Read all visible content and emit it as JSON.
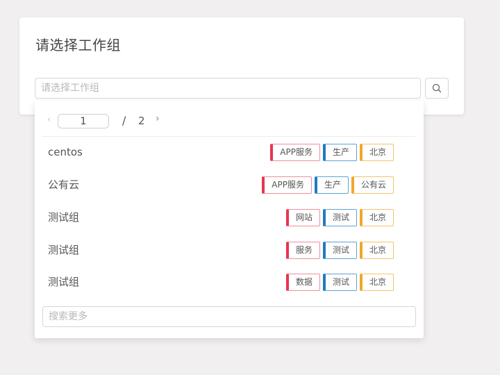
{
  "card": {
    "title": "请选择工作组",
    "search_placeholder": "请选择工作组",
    "search_value": ""
  },
  "pager": {
    "prev_icon": "chevron-left-icon",
    "current_page": "1",
    "separator": "/",
    "total_pages": "2",
    "next_icon": "chevron-right-icon"
  },
  "items": [
    {
      "name": "centos",
      "tags": [
        {
          "text": "APP服务",
          "color": "red"
        },
        {
          "text": "生产",
          "color": "blue"
        },
        {
          "text": "北京",
          "color": "orange"
        }
      ]
    },
    {
      "name": "公有云",
      "tags": [
        {
          "text": "APP服务",
          "color": "red"
        },
        {
          "text": "生产",
          "color": "blue"
        },
        {
          "text": "公有云",
          "color": "orange"
        }
      ]
    },
    {
      "name": "测试组",
      "tags": [
        {
          "text": "网站",
          "color": "red"
        },
        {
          "text": "测试",
          "color": "blue"
        },
        {
          "text": "北京",
          "color": "orange"
        }
      ]
    },
    {
      "name": "测试组",
      "tags": [
        {
          "text": "服务",
          "color": "red"
        },
        {
          "text": "测试",
          "color": "blue"
        },
        {
          "text": "北京",
          "color": "orange"
        }
      ]
    },
    {
      "name": "测试组",
      "tags": [
        {
          "text": "数据",
          "color": "red"
        },
        {
          "text": "测试",
          "color": "blue"
        },
        {
          "text": "北京",
          "color": "orange"
        }
      ]
    }
  ],
  "more_search": {
    "placeholder": "搜索更多",
    "value": ""
  },
  "colors": {
    "red": "#e8344e",
    "blue": "#1f7bc2",
    "orange": "#f1a62b"
  }
}
